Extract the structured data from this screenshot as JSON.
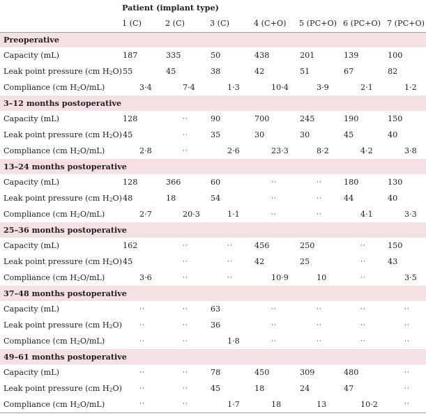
{
  "header": {
    "group_label": "Patient (implant type)",
    "columns": [
      "1 (C)",
      "2 (C)",
      "3 (C)",
      "4 (C+O)",
      "5 (PC+O)",
      "6 (PC+O)",
      "7 (PC+O)"
    ]
  },
  "row_labels": {
    "capacity": "Capacity (mL)",
    "leak_pre": "Leak point pressure (cm H",
    "leak_post": "O)",
    "comp_pre": "Compliance (cm H",
    "comp_post": "O/mL)",
    "sub": "2"
  },
  "sections": [
    {
      "title": "Preoperative",
      "capacity": [
        "187",
        "335",
        "50",
        "438",
        "201",
        "139",
        "100"
      ],
      "leak": [
        "55",
        "45",
        "38",
        "42",
        "51",
        "67",
        "82"
      ],
      "compliance": [
        "3·4",
        "7·4",
        "1·3",
        "10·4",
        "3·9",
        "2·1",
        "1·2"
      ]
    },
    {
      "title": "3–12 months postoperative",
      "capacity": [
        "128",
        "··",
        "90",
        "700",
        "245",
        "190",
        "150"
      ],
      "leak": [
        "45",
        "··",
        "35",
        "30",
        "30",
        "45",
        "40"
      ],
      "compliance": [
        "2·8",
        "··",
        "2·6",
        "23·3",
        "8·2",
        "4·2",
        "3·8"
      ]
    },
    {
      "title": "13–24 months postoperative",
      "capacity": [
        "128",
        "366",
        "60",
        "··",
        "··",
        "180",
        "130"
      ],
      "leak": [
        "48",
        "18",
        "54",
        "··",
        "··",
        "44",
        "40"
      ],
      "compliance": [
        "2·7",
        "20·3",
        "1·1",
        "··",
        "··",
        "4·1",
        "3·3"
      ]
    },
    {
      "title": "25–36 months postoperative",
      "capacity": [
        "162",
        "··",
        "··",
        "456",
        "250",
        "··",
        "150"
      ],
      "leak": [
        "45",
        "··",
        "··",
        "42",
        "25",
        "··",
        "43"
      ],
      "compliance": [
        "3·6",
        "··",
        "··",
        "10·9",
        "10",
        "··",
        "3·5"
      ]
    },
    {
      "title": "37–48 months postoperative",
      "capacity": [
        "··",
        "··",
        "63",
        "··",
        "··",
        "··",
        "··"
      ],
      "leak": [
        "··",
        "··",
        "36",
        "··",
        "··",
        "··",
        "··"
      ],
      "compliance": [
        "··",
        "··",
        "1·8",
        "··",
        "··",
        "··",
        "··"
      ]
    },
    {
      "title": "49–61 months postoperative",
      "capacity": [
        "··",
        "··",
        "78",
        "450",
        "309",
        "480",
        "··"
      ],
      "leak": [
        "··",
        "··",
        "45",
        "18",
        "24",
        "47",
        "··"
      ],
      "compliance": [
        "··",
        "··",
        "1·7",
        "18",
        "13",
        "10·2",
        "··"
      ]
    }
  ]
}
